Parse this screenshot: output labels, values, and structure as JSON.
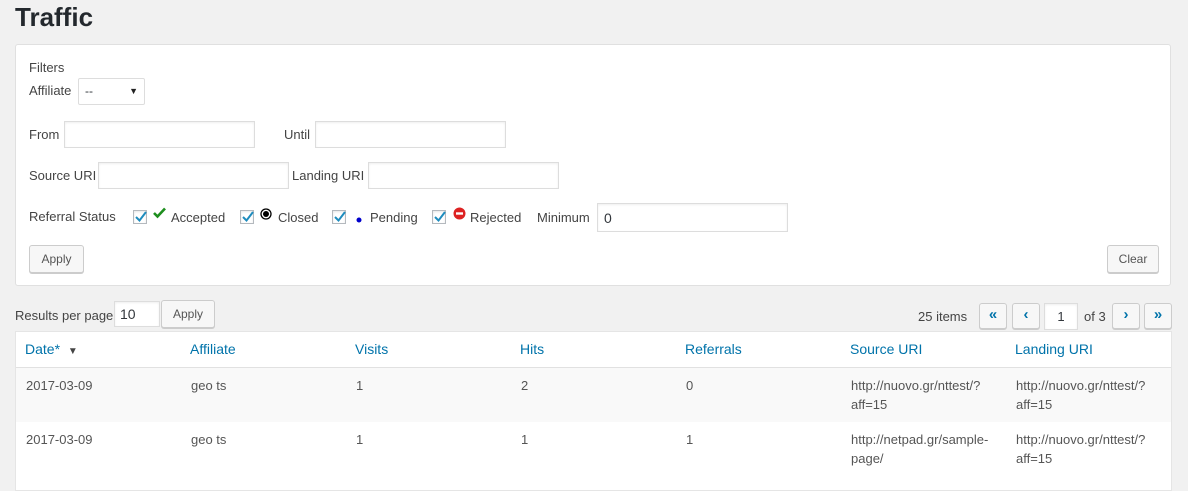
{
  "page": {
    "title": "Traffic"
  },
  "filters": {
    "heading": "Filters",
    "affiliate_label": "Affiliate",
    "affiliate_value": "--",
    "from_label": "From",
    "from_value": "",
    "until_label": "Until",
    "until_value": "",
    "source_uri_label": "Source URI",
    "source_uri_value": "",
    "landing_uri_label": "Landing URI",
    "landing_uri_value": "",
    "referral_status_label": "Referral Status",
    "statuses": [
      {
        "label": "Accepted",
        "checked": true,
        "icon": "checkmark-icon",
        "color": "#1e8e1e"
      },
      {
        "label": "Closed",
        "checked": true,
        "icon": "closed-circle-icon",
        "color": "#000000"
      },
      {
        "label": "Pending",
        "checked": true,
        "icon": "pending-dot-icon",
        "color": "#0000cc"
      },
      {
        "label": "Rejected",
        "checked": true,
        "icon": "rejected-icon",
        "color": "#dd2222"
      }
    ],
    "minimum_label": "Minimum",
    "minimum_value": "0",
    "apply_label": "Apply",
    "clear_label": "Clear"
  },
  "results": {
    "per_page_label": "Results per page",
    "per_page_value": "10",
    "apply_label": "Apply"
  },
  "pagination": {
    "items_text": "25 items",
    "first": "«",
    "prev": "‹",
    "current_page": "1",
    "of_text": "of 3",
    "next": "›",
    "last": "»"
  },
  "table": {
    "columns": [
      "Date*",
      "Affiliate",
      "Visits",
      "Hits",
      "Referrals",
      "Source URI",
      "Landing URI"
    ],
    "sort_indicator": "▼",
    "rows": [
      {
        "date": "2017-03-09",
        "affiliate": "geo ts",
        "visits": "1",
        "hits": "2",
        "referrals": "0",
        "source_uri_1": "http://nuovo.gr/nttest/?",
        "source_uri_2": "aff=15",
        "landing_uri_1": "http://nuovo.gr/nttest/?",
        "landing_uri_2": "aff=15"
      },
      {
        "date": "2017-03-09",
        "affiliate": "geo ts",
        "visits": "1",
        "hits": "1",
        "referrals": "1",
        "source_uri_1": "http://netpad.gr/sample-",
        "source_uri_2": "page/",
        "landing_uri_1": "http://nuovo.gr/nttest/?",
        "landing_uri_2": "aff=15"
      }
    ]
  },
  "colors": {
    "link": "#0073aa",
    "background": "#f1f1f1"
  }
}
